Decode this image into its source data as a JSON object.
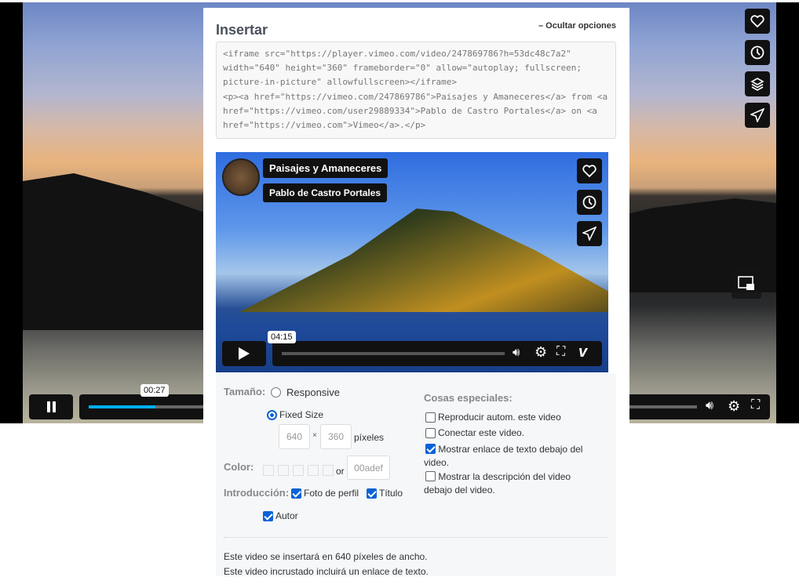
{
  "background_player": {
    "time_tooltip": "00:27",
    "progress_percent": 11,
    "buttons": [
      "heart-icon",
      "clock-icon",
      "layers-icon",
      "send-icon"
    ]
  },
  "embed": {
    "title": "Insertar",
    "hide_options": "– Ocultar opciones",
    "code": "<iframe src=\"https://player.vimeo.com/video/247869786?h=53dc48c7a2\" width=\"640\" height=\"360\" frameborder=\"0\" allow=\"autoplay; fullscreen; picture-in-picture\" allowfullscreen></iframe>\n<p><a href=\"https://vimeo.com/247869786\">Paisajes y Amaneceres</a> from <a href=\"https://vimeo.com/user29889334\">Pablo de Castro Portales</a> on <a href=\"https://vimeo.com\">Vimeo</a>.</p>"
  },
  "preview": {
    "title": "Paisajes y Amaneceres",
    "author": "Pablo de Castro Portales",
    "time_tooltip": "04:15",
    "progress_percent": 0
  },
  "options": {
    "size_label": "Tamaño:",
    "responsive": "Responsive",
    "fixed": "Fixed Size",
    "width": "640",
    "times": "×",
    "height": "360",
    "pixels": "píxeles",
    "color_label": "Color:",
    "or": "or",
    "color_value": "00adef",
    "intro_label": "Introducción:",
    "profile": "Foto de perfil",
    "title_opt": "Título",
    "author": "Autor",
    "special_label": "Cosas especiales:",
    "autoplay": "Reproducir autom. este video",
    "loop": "Conectar este video.",
    "show_link": "Mostrar enlace de texto debajo del video.",
    "show_desc": "Mostrar la descripción del video debajo del video.",
    "note1": "Este video se insertará en 640 píxeles de ancho.",
    "note2": "Este video incrustado incluirá un enlace de texto."
  },
  "colors": {
    "accent": "#0b62d6",
    "progress": "#00adef"
  }
}
